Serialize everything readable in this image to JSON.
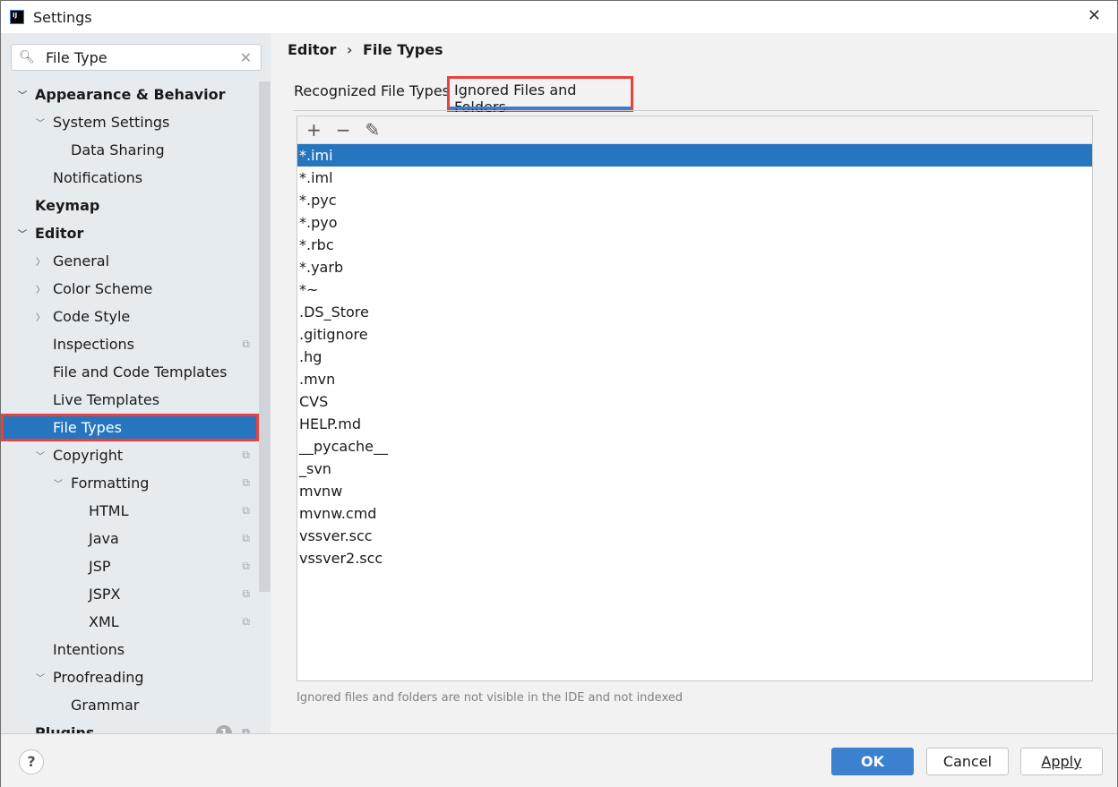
{
  "window": {
    "title": "Settings",
    "close": "✕"
  },
  "search": {
    "value": "File Type"
  },
  "tree": [
    {
      "label": "Appearance & Behavior",
      "level": 0,
      "arrow": "down",
      "bold": true
    },
    {
      "label": "System Settings",
      "level": 1,
      "arrow": "down"
    },
    {
      "label": "Data Sharing",
      "level": 2
    },
    {
      "label": "Notifications",
      "level": 1
    },
    {
      "label": "Keymap",
      "level": 0,
      "bold": true
    },
    {
      "label": "Editor",
      "level": 0,
      "arrow": "down",
      "bold": true
    },
    {
      "label": "General",
      "level": 1,
      "arrow": "right"
    },
    {
      "label": "Color Scheme",
      "level": 1,
      "arrow": "right"
    },
    {
      "label": "Code Style",
      "level": 1,
      "arrow": "right"
    },
    {
      "label": "Inspections",
      "level": 1,
      "copy": true
    },
    {
      "label": "File and Code Templates",
      "level": 1
    },
    {
      "label": "Live Templates",
      "level": 1
    },
    {
      "label": "File Types",
      "level": 1,
      "selected": true
    },
    {
      "label": "Copyright",
      "level": 1,
      "arrow": "down",
      "copy": true
    },
    {
      "label": "Formatting",
      "level": 2,
      "arrow": "down",
      "copy": true
    },
    {
      "label": "HTML",
      "level": 3,
      "copy": true
    },
    {
      "label": "Java",
      "level": 3,
      "copy": true
    },
    {
      "label": "JSP",
      "level": 3,
      "copy": true
    },
    {
      "label": "JSPX",
      "level": 3,
      "copy": true
    },
    {
      "label": "XML",
      "level": 3,
      "copy": true
    },
    {
      "label": "Intentions",
      "level": 1
    },
    {
      "label": "Proofreading",
      "level": 1,
      "arrow": "down"
    },
    {
      "label": "Grammar",
      "level": 2
    },
    {
      "label": "Plugins",
      "level": 0,
      "bold": true,
      "badge": "1",
      "copy": true
    }
  ],
  "breadcrumb": {
    "parent": "Editor",
    "sep": "›",
    "current": "File Types"
  },
  "tabs": {
    "recognized": "Recognized File Types",
    "ignored": "Ignored Files and Folders"
  },
  "toolbar": {
    "add": "+",
    "remove": "−",
    "edit": "✎"
  },
  "patterns": [
    "*.imi",
    "*.iml",
    "*.pyc",
    "*.pyo",
    "*.rbc",
    "*.yarb",
    "*~",
    ".DS_Store",
    ".gitignore",
    ".hg",
    ".mvn",
    "CVS",
    "HELP.md",
    "__pycache__",
    "_svn",
    "mvnw",
    "mvnw.cmd",
    "vssver.scc",
    "vssver2.scc"
  ],
  "selected_pattern": "*.imi",
  "hint": "Ignored files and folders are not visible in the IDE and not indexed",
  "footer": {
    "help": "?",
    "ok": "OK",
    "cancel": "Cancel",
    "apply": "Apply"
  }
}
